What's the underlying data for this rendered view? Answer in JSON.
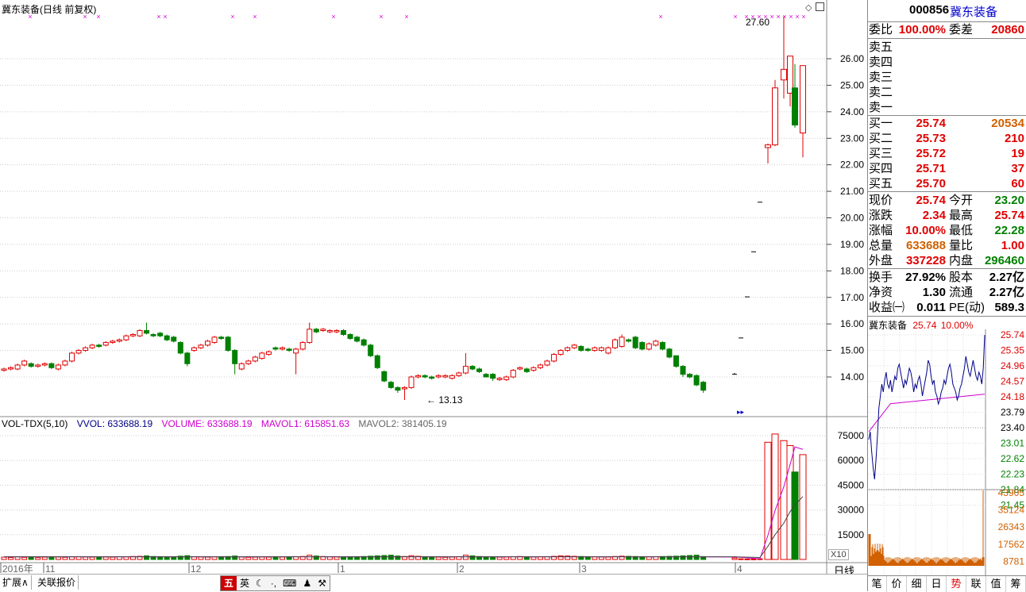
{
  "chart_title": "冀东装备(日线 前复权)",
  "price_axis": [
    "26.00",
    "25.00",
    "24.00",
    "23.00",
    "22.00",
    "21.00",
    "20.00",
    "19.00",
    "18.00",
    "17.00",
    "16.00",
    "15.00",
    "14.00"
  ],
  "annotations": {
    "high_label": "27.60",
    "low_label": "13.13"
  },
  "vol_legend": {
    "indicator": "VOL-TDX(5,10)",
    "vvol": "VVOL: 633688.19",
    "volume": "VOLUME: 633688.19",
    "mavol1": "MAVOL1: 615851.63",
    "mavol2": "MAVOL2: 381405.19"
  },
  "vol_axis": [
    "75000",
    "60000",
    "45000",
    "30000",
    "15000"
  ],
  "vol_multiplier": "X10",
  "time_axis": [
    "2016年",
    "11",
    "12",
    "1",
    "2",
    "3",
    "4"
  ],
  "period_label": "日线",
  "bottom_buttons": {
    "expand": "扩展∧",
    "related": "关联报价"
  },
  "ime": {
    "wu": "五",
    "ying": "英",
    "moon": "☾",
    "dots": "·,",
    "kbd": "⌨",
    "user": "♟",
    "wrench": "⚒"
  },
  "quote": {
    "code": "000856",
    "name": "冀东装备",
    "weibi_label": "委比",
    "weibi": "100.00%",
    "weicha_label": "委差",
    "weicha": "20860",
    "sell": [
      {
        "label": "卖五",
        "price": "",
        "vol": ""
      },
      {
        "label": "卖四",
        "price": "",
        "vol": ""
      },
      {
        "label": "卖三",
        "price": "",
        "vol": ""
      },
      {
        "label": "卖二",
        "price": "",
        "vol": ""
      },
      {
        "label": "卖一",
        "price": "",
        "vol": ""
      }
    ],
    "buy": [
      {
        "label": "买一",
        "price": "25.74",
        "vol": "20534"
      },
      {
        "label": "买二",
        "price": "25.73",
        "vol": "210"
      },
      {
        "label": "买三",
        "price": "25.72",
        "vol": "19"
      },
      {
        "label": "买四",
        "price": "25.71",
        "vol": "37"
      },
      {
        "label": "买五",
        "price": "25.70",
        "vol": "60"
      }
    ],
    "stats": [
      {
        "l1": "现价",
        "v1": "25.74",
        "l2": "今开",
        "v2": "23.20",
        "c1": "red",
        "c2": "green"
      },
      {
        "l1": "涨跌",
        "v1": "2.34",
        "l2": "最高",
        "v2": "25.74",
        "c1": "red",
        "c2": "red"
      },
      {
        "l1": "涨幅",
        "v1": "10.00%",
        "l2": "最低",
        "v2": "22.28",
        "c1": "red",
        "c2": "green"
      },
      {
        "l1": "总量",
        "v1": "633688",
        "l2": "量比",
        "v2": "1.00",
        "c1": "orange",
        "c2": "red"
      },
      {
        "l1": "外盘",
        "v1": "337228",
        "l2": "内盘",
        "v2": "296460",
        "c1": "red",
        "c2": "green"
      }
    ],
    "finance": [
      {
        "l1": "换手",
        "v1": "27.92%",
        "l2": "股本",
        "v2": "2.27亿"
      },
      {
        "l1": "净资",
        "v1": "1.30",
        "l2": "流通",
        "v2": "2.27亿"
      },
      {
        "l1": "收益㈠",
        "v1": "0.011",
        "l2": "PE(动)",
        "v2": "589.3"
      }
    ],
    "intraday_header": {
      "name": "冀东装备",
      "price": "25.74",
      "pct": "10.00%"
    },
    "intraday_axis": [
      "25.74",
      "25.35",
      "24.96",
      "24.57",
      "24.18",
      "23.79",
      "23.40",
      "23.01",
      "22.62",
      "22.23",
      "21.84",
      "21.45"
    ],
    "intraday_vol_axis": [
      "43905",
      "35124",
      "26343",
      "17562",
      "8781"
    ],
    "tabs": [
      "笔",
      "价",
      "细",
      "日",
      "势",
      "联",
      "值",
      "筹"
    ],
    "active_tab": "势"
  },
  "colors": {
    "up": "#e00000",
    "down": "#008000",
    "marker": "#dd00dd",
    "avg": "#cc00cc",
    "price_line": "#00008b"
  },
  "chart_data": {
    "type": "candlestick",
    "open": [
      14.25,
      14.3,
      14.3,
      14.45,
      14.5,
      14.4,
      14.45,
      14.5,
      14.3,
      14.45,
      14.6,
      14.9,
      15.0,
      15.1,
      15.2,
      15.2,
      15.3,
      15.35,
      15.4,
      15.55,
      15.55,
      15.75,
      15.6,
      15.65,
      15.55,
      15.5,
      15.3,
      14.9,
      15.0,
      15.1,
      15.2,
      15.3,
      15.5,
      15.5,
      15.0,
      14.3,
      14.5,
      14.6,
      14.7,
      14.85,
      15.1,
      15.05,
      15.05,
      14.9,
      15.05,
      15.3,
      15.8,
      15.75,
      15.7,
      15.7,
      15.75,
      15.6,
      15.5,
      15.4,
      15.2,
      14.8,
      14.2,
      13.8,
      13.6,
      13.55,
      13.6,
      14.0,
      14.05,
      14.0,
      14.0,
      14.0,
      13.95,
      14.05,
      14.15,
      14.4,
      14.3,
      14.1,
      14.1,
      13.9,
      13.9,
      14.0,
      14.3,
      14.3,
      14.25,
      14.35,
      14.45,
      14.6,
      14.85,
      15.0,
      15.1,
      15.15,
      15.05,
      15.0,
      15.0,
      14.9,
      15.1,
      15.15,
      15.4,
      15.5,
      15.3,
      15.05,
      15.2,
      15.3,
      15.05,
      14.8,
      14.4,
      14.1,
      14.05,
      13.8
    ],
    "close": [
      14.3,
      14.35,
      14.45,
      14.6,
      14.4,
      14.45,
      14.5,
      14.35,
      14.45,
      14.6,
      14.9,
      15.0,
      15.1,
      15.2,
      15.15,
      15.3,
      15.35,
      15.4,
      15.55,
      15.6,
      15.75,
      15.65,
      15.55,
      15.55,
      15.4,
      15.35,
      14.9,
      14.5,
      15.1,
      15.2,
      15.35,
      15.5,
      15.45,
      15.0,
      14.5,
      14.5,
      14.6,
      14.75,
      14.9,
      14.95,
      15.05,
      15.1,
      15.0,
      15.05,
      15.3,
      15.8,
      15.7,
      15.8,
      15.75,
      15.75,
      15.6,
      15.45,
      15.35,
      15.2,
      14.8,
      14.35,
      13.85,
      13.6,
      13.5,
      13.6,
      14.0,
      14.05,
      14.0,
      13.95,
      14.05,
      14.05,
      14.05,
      14.15,
      14.4,
      14.3,
      14.2,
      14.0,
      13.95,
      13.95,
      14.0,
      14.25,
      14.35,
      14.2,
      14.35,
      14.45,
      14.6,
      14.85,
      15.0,
      15.1,
      15.2,
      15.0,
      15.0,
      15.1,
      15.1,
      15.1,
      15.4,
      15.5,
      15.35,
      15.1,
      15.05,
      15.25,
      15.35,
      15.05,
      14.75,
      14.4,
      14.1,
      14.0,
      13.7,
      13.5
    ],
    "high": [
      14.35,
      14.4,
      14.5,
      14.65,
      14.55,
      14.5,
      14.55,
      14.55,
      14.5,
      14.65,
      14.95,
      15.05,
      15.15,
      15.25,
      15.25,
      15.35,
      15.4,
      15.45,
      15.6,
      15.65,
      15.8,
      16.05,
      15.65,
      15.7,
      15.6,
      15.55,
      15.35,
      14.95,
      15.15,
      15.25,
      15.4,
      15.55,
      15.55,
      15.55,
      15.05,
      14.55,
      14.65,
      14.8,
      14.95,
      15.0,
      15.15,
      15.15,
      15.1,
      15.1,
      15.35,
      16.05,
      15.85,
      15.85,
      15.8,
      15.8,
      15.8,
      15.65,
      15.55,
      15.45,
      15.25,
      14.85,
      14.25,
      13.85,
      13.65,
      13.65,
      14.05,
      14.1,
      14.1,
      14.05,
      14.1,
      14.1,
      14.1,
      14.2,
      14.9,
      14.45,
      14.35,
      14.15,
      14.15,
      14.0,
      14.05,
      14.3,
      14.4,
      14.35,
      14.4,
      14.5,
      14.65,
      14.9,
      15.05,
      15.15,
      15.25,
      15.2,
      15.1,
      15.15,
      15.15,
      15.15,
      15.45,
      15.6,
      15.45,
      15.55,
      15.35,
      15.3,
      15.4,
      15.35,
      15.1,
      14.8,
      14.45,
      14.15,
      14.1,
      13.85
    ],
    "low": [
      14.2,
      14.25,
      14.25,
      14.4,
      14.35,
      14.35,
      14.4,
      14.3,
      14.25,
      14.4,
      14.55,
      14.85,
      14.95,
      15.05,
      15.1,
      15.15,
      15.25,
      15.3,
      15.35,
      15.5,
      15.5,
      15.6,
      15.5,
      15.5,
      15.35,
      15.3,
      14.85,
      14.4,
      14.95,
      15.05,
      15.15,
      15.25,
      15.4,
      14.95,
      14.1,
      14.25,
      14.45,
      14.55,
      14.65,
      14.8,
      15.0,
      15.0,
      14.95,
      14.1,
      15.0,
      15.25,
      15.65,
      15.7,
      15.65,
      15.65,
      15.55,
      15.4,
      15.3,
      15.15,
      14.75,
      14.3,
      13.8,
      13.55,
      13.4,
      13.13,
      13.55,
      13.95,
      13.95,
      13.9,
      13.95,
      13.95,
      13.9,
      14.0,
      14.1,
      14.25,
      14.15,
      14.0,
      13.85,
      13.85,
      13.85,
      13.95,
      14.25,
      14.15,
      14.2,
      14.3,
      14.4,
      14.55,
      14.8,
      14.95,
      15.05,
      14.95,
      14.95,
      14.95,
      14.95,
      14.85,
      15.05,
      15.1,
      15.3,
      15.05,
      15.0,
      15.0,
      15.15,
      15.0,
      14.7,
      14.35,
      14.0,
      13.95,
      13.65,
      13.4
    ],
    "tail": [
      {
        "open": 14.1,
        "close": 14.1,
        "high": 14.15,
        "low": 14.1
      },
      {
        "open": 15.47,
        "close": 15.47,
        "high": 15.47,
        "low": 15.47
      },
      {
        "open": 17.02,
        "close": 17.02,
        "high": 17.02,
        "low": 17.02
      },
      {
        "open": 18.72,
        "close": 18.72,
        "high": 18.72,
        "low": 18.72
      },
      {
        "open": 20.59,
        "close": 20.59,
        "high": 20.59,
        "low": 20.59
      },
      {
        "open": 22.65,
        "close": 22.75,
        "high": 22.8,
        "low": 22.05
      },
      {
        "open": 22.75,
        "close": 24.9,
        "high": 25.2,
        "low": 22.7
      },
      {
        "open": 25.2,
        "close": 25.6,
        "high": 27.6,
        "low": 24.5
      },
      {
        "open": 24.7,
        "close": 26.1,
        "high": 26.1,
        "low": 24.2
      },
      {
        "open": 24.9,
        "close": 23.5,
        "high": 25.8,
        "low": 23.4
      },
      {
        "open": 23.2,
        "close": 25.74,
        "high": 25.74,
        "low": 22.28
      }
    ],
    "volume_base": [
      1400,
      1200,
      1600,
      1300,
      1500,
      1100,
      1400,
      1200,
      1500,
      1300,
      1600,
      1700,
      1500,
      1400,
      1300,
      1500,
      1400,
      1700,
      1600,
      1800,
      1900,
      2200,
      1800,
      1700,
      1500,
      1400,
      2000,
      2300,
      1600,
      1500,
      1400,
      1600,
      1700,
      1800,
      2100,
      1500,
      1300,
      1400,
      1500,
      1400,
      1600,
      1500,
      1400,
      1700,
      1800,
      2600,
      2100,
      1800,
      1600,
      1500,
      1400,
      1500,
      1700,
      1800,
      2000,
      2200,
      2400,
      2600,
      2100,
      1800,
      2300,
      1900,
      1600,
      1500,
      1400,
      1300,
      1500,
      1700,
      2600,
      2200,
      1800,
      1600,
      1500,
      1400,
      1500,
      1700,
      1800,
      1600,
      1500,
      1600,
      1700,
      1900,
      2200,
      2100,
      1900,
      1800,
      1700,
      1600,
      1500,
      1500,
      1800,
      2000,
      1900,
      1800,
      1700,
      1600,
      1700,
      1800,
      1900,
      2000,
      2200,
      2400,
      2600,
      1700
    ],
    "volume_tail": [
      900,
      400,
      300,
      300,
      400,
      71000,
      76000,
      72000,
      69000,
      53000,
      63500
    ],
    "mavol1_tail": [
      1500,
      1300,
      1000,
      700,
      500,
      14600,
      29600,
      44000,
      57600,
      68200,
      66700
    ],
    "mavol2_tail": [
      1600,
      1500,
      1400,
      1300,
      1200,
      8000,
      15000,
      22000,
      29000,
      33000,
      38140
    ]
  }
}
